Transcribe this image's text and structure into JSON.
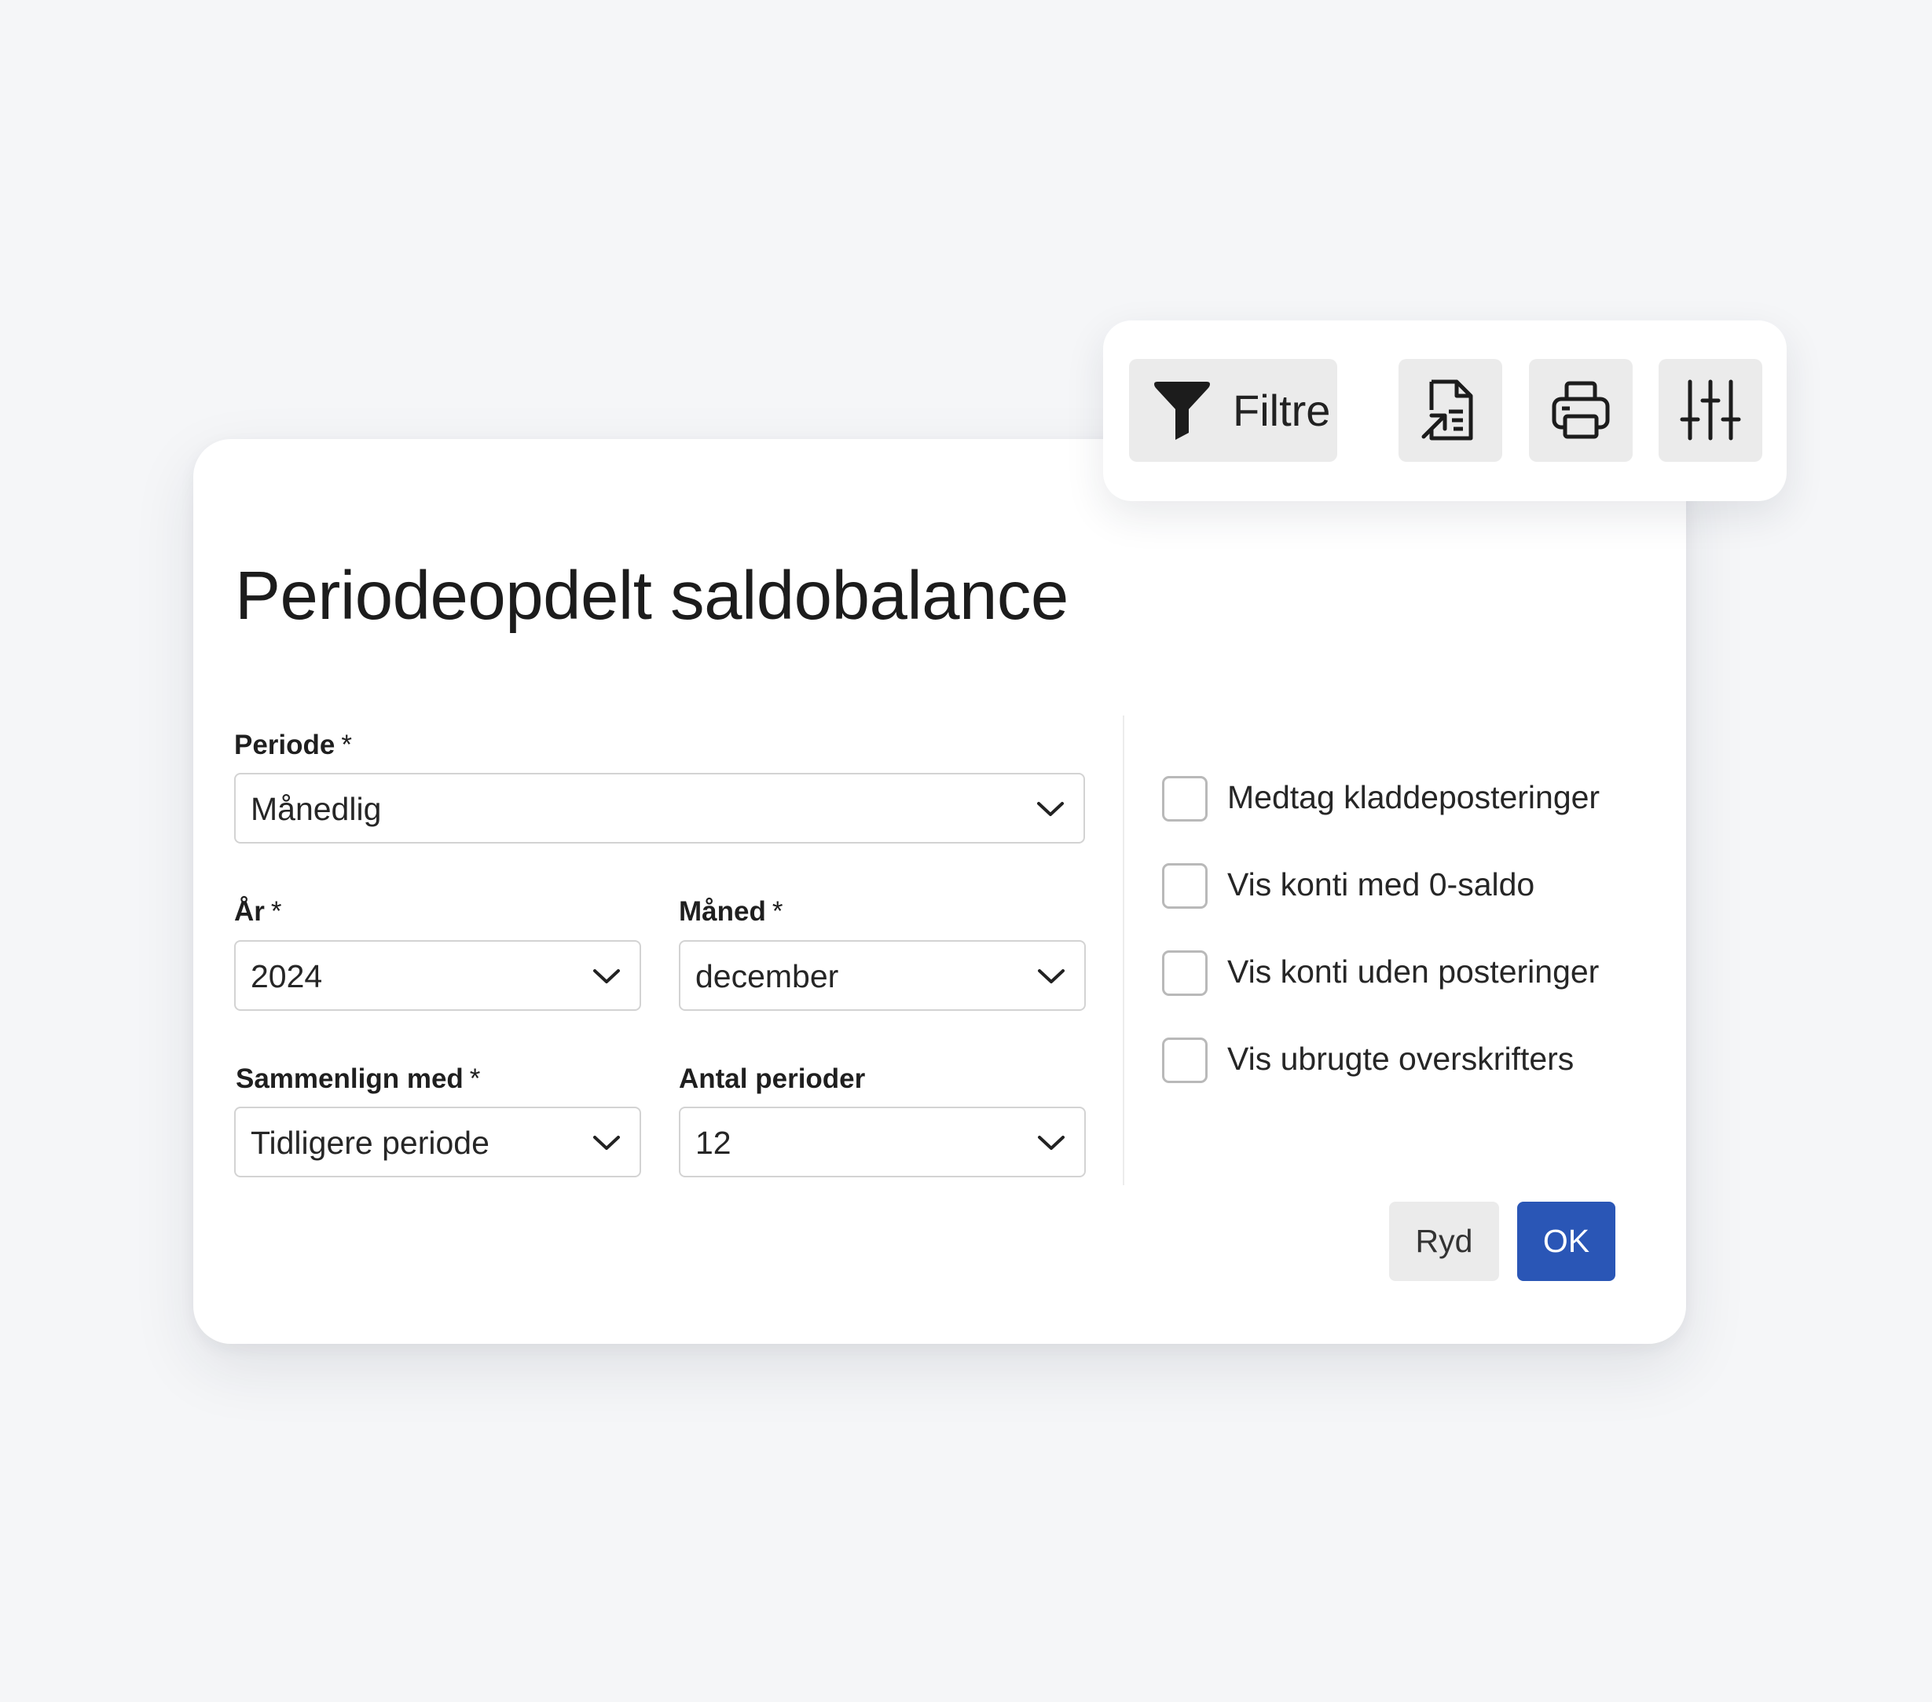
{
  "toolbar": {
    "filter_label": "Filtre",
    "icons": [
      "filter-funnel-icon",
      "export-document-icon",
      "printer-icon",
      "sliders-icon"
    ]
  },
  "form": {
    "title": "Periodeopdelt saldobalance",
    "fields": {
      "periode": {
        "label": "Periode",
        "required_mark": "*",
        "value": "Månedlig"
      },
      "aar": {
        "label": "År",
        "required_mark": "*",
        "value": "2024"
      },
      "maaned": {
        "label": "Måned",
        "required_mark": "*",
        "value": "december"
      },
      "sammenlign": {
        "label": "Sammenlign med",
        "required_mark": "*",
        "value": "Tidligere periode"
      },
      "antal": {
        "label": "Antal perioder",
        "value": "12"
      }
    },
    "checkboxes": [
      {
        "label": "Medtag kladdeposteringer",
        "checked": false
      },
      {
        "label": "Vis konti med 0-saldo",
        "checked": false
      },
      {
        "label": "Vis konti uden posteringer",
        "checked": false
      },
      {
        "label": "Vis ubrugte overskrifters",
        "checked": false
      }
    ],
    "buttons": {
      "clear": "Ryd",
      "ok": "OK"
    }
  },
  "colors": {
    "background": "#f5f6f8",
    "card": "#ffffff",
    "primary_button": "#2a56b6",
    "secondary_button": "#ebebeb",
    "input_border": "#d3d3d3",
    "checkbox_border": "#b9b9b9"
  }
}
